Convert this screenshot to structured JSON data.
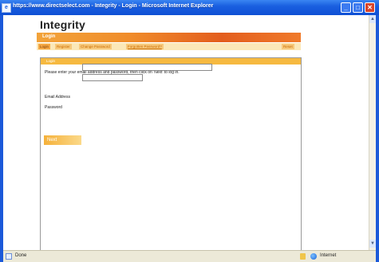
{
  "window": {
    "title": "https://www.directselect.com - Integrity - Login - Microsoft Internet Explorer",
    "controls": {
      "minimize": "_",
      "maximize": "□",
      "close": "✕"
    }
  },
  "brand": {
    "logo_text": "Integrity",
    "logo_mark_colors": [
      "#f2a23a",
      "#e44b1f",
      "#222222",
      "#f6c24a"
    ]
  },
  "banner": {
    "label": "Login"
  },
  "nav": {
    "tabs": [
      {
        "label": "Login"
      },
      {
        "label": "Register"
      },
      {
        "label": "Change Password"
      },
      {
        "label": "Forgotten Password?"
      },
      {
        "label": "Reset"
      }
    ]
  },
  "panel": {
    "header": "Login",
    "instructions": "Please enter your email address and password, then click on 'Next' to log in.",
    "email_label": "Email Address",
    "email_value": "",
    "password_label": "Password",
    "password_value": "",
    "next_label": "Next"
  },
  "scrollbar": {
    "up_glyph": "▲",
    "down_glyph": "▼"
  },
  "statusbar": {
    "status": "Done",
    "zone": "Internet"
  },
  "colors": {
    "accent_orange": "#f08c2a",
    "tab_background": "#f7c97b",
    "panel_header": "#f6b940",
    "titlebar_blue": "#1a5fe0"
  }
}
